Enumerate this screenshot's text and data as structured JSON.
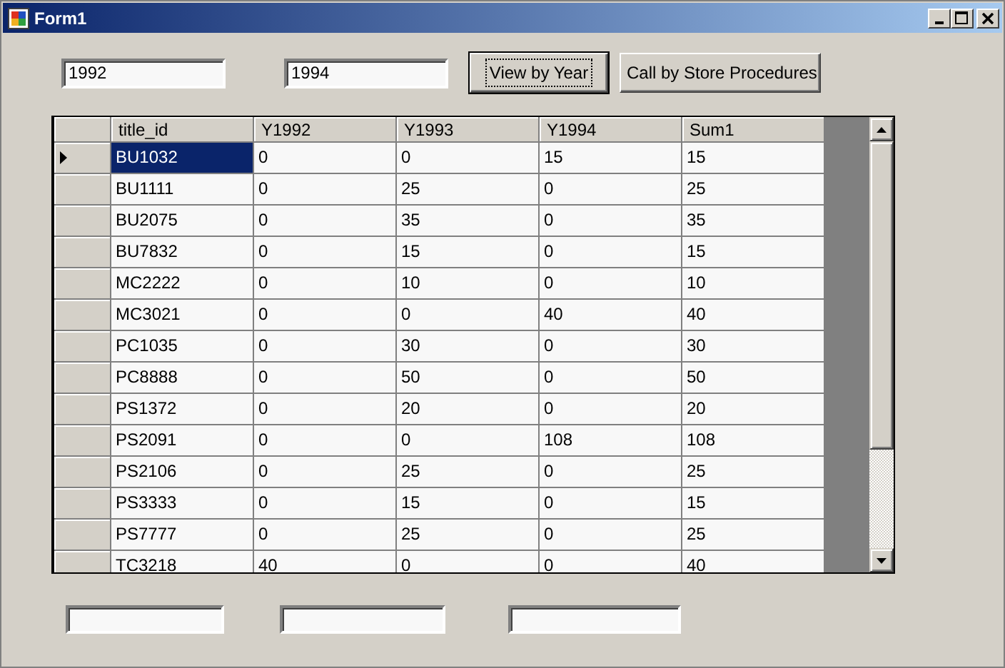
{
  "window": {
    "title": "Form1"
  },
  "top_fields": [
    {
      "value": "1992"
    },
    {
      "value": "1994"
    }
  ],
  "buttons": [
    {
      "label": "View by Year",
      "focused": true
    },
    {
      "label": "Call by Store Procedures",
      "focused": false
    }
  ],
  "table": {
    "columns": [
      "title_id",
      "Y1992",
      "Y1993",
      "Y1994",
      "Sum1"
    ],
    "rows": [
      {
        "selected": true,
        "cells": [
          "BU1032",
          "0",
          "0",
          "15",
          "15"
        ]
      },
      {
        "selected": false,
        "cells": [
          "BU1111",
          "0",
          "25",
          "0",
          "25"
        ]
      },
      {
        "selected": false,
        "cells": [
          "BU2075",
          "0",
          "35",
          "0",
          "35"
        ]
      },
      {
        "selected": false,
        "cells": [
          "BU7832",
          "0",
          "15",
          "0",
          "15"
        ]
      },
      {
        "selected": false,
        "cells": [
          "MC2222",
          "0",
          "10",
          "0",
          "10"
        ]
      },
      {
        "selected": false,
        "cells": [
          "MC3021",
          "0",
          "0",
          "40",
          "40"
        ]
      },
      {
        "selected": false,
        "cells": [
          "PC1035",
          "0",
          "30",
          "0",
          "30"
        ]
      },
      {
        "selected": false,
        "cells": [
          "PC8888",
          "0",
          "50",
          "0",
          "50"
        ]
      },
      {
        "selected": false,
        "cells": [
          "PS1372",
          "0",
          "20",
          "0",
          "20"
        ]
      },
      {
        "selected": false,
        "cells": [
          "PS2091",
          "0",
          "0",
          "108",
          "108"
        ]
      },
      {
        "selected": false,
        "cells": [
          "PS2106",
          "0",
          "25",
          "0",
          "25"
        ]
      },
      {
        "selected": false,
        "cells": [
          "PS3333",
          "0",
          "15",
          "0",
          "15"
        ]
      },
      {
        "selected": false,
        "cells": [
          "PS7777",
          "0",
          "25",
          "0",
          "25"
        ]
      },
      {
        "selected": false,
        "cells": [
          "TC3218",
          "40",
          "0",
          "0",
          "40"
        ]
      }
    ]
  },
  "bottom_fields": [
    {
      "kind": "textbox"
    },
    {
      "kind": "textbox"
    },
    {
      "kind": "textbox"
    }
  ]
}
